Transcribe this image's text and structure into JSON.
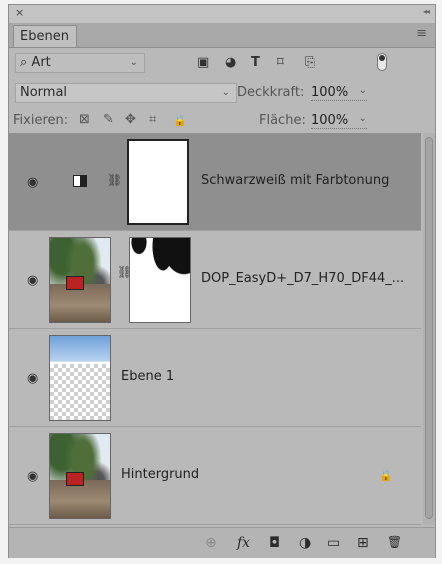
{
  "panel": {
    "tab_label": "Ebenen",
    "close_glyph": "×",
    "collapse_glyph": "◂◂",
    "menu_glyph": "≡"
  },
  "filter": {
    "search_glyph": "⌕",
    "kind_label": "Art",
    "chevron": "⌄",
    "icons": [
      "pixel-filter-icon",
      "adjustment-filter-icon",
      "type-filter-icon",
      "shape-filter-icon",
      "smart-object-filter-icon"
    ],
    "glyphs": [
      "▣",
      "◕",
      "T",
      "⌑",
      "⎘"
    ]
  },
  "blend": {
    "mode": "Normal",
    "opacity_label": "Deckkraft:",
    "opacity_value": "100%"
  },
  "lock": {
    "label": "Fixieren:",
    "glyphs": [
      "⊠",
      "✎",
      "✥",
      "⌗",
      "🔒"
    ],
    "fill_label": "Fläche:",
    "fill_value": "100%"
  },
  "layers": [
    {
      "name": "Schwarzweiß mit Farbtonung",
      "selected": true
    },
    {
      "name": "DOP_EasyD+_D7_H70_DF44_...",
      "selected": false
    },
    {
      "name": "Ebene 1",
      "selected": false
    },
    {
      "name": "Hintergrund",
      "selected": false
    }
  ],
  "layer_glyphs": {
    "eye": "◉",
    "chain": "⛓",
    "lock": "🔒"
  },
  "bottom": {
    "glyphs": [
      "⊕",
      "fx",
      "◘",
      "◑",
      "▭",
      "⊞",
      "🗑"
    ]
  }
}
